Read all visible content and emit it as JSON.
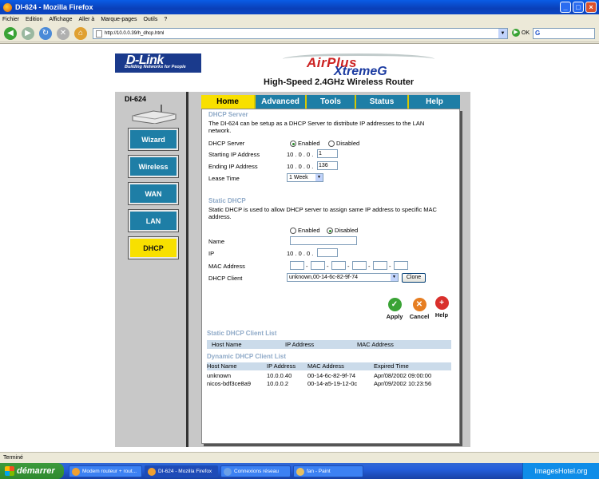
{
  "window": {
    "title": "DI-624 - Mozilla Firefox"
  },
  "menu": [
    "Fichier",
    "Edition",
    "Affichage",
    "Aller à",
    "Marque-pages",
    "Outils",
    "?"
  ],
  "nav": {
    "url": "http://10.0.0.39/h_dhcp.html",
    "ok_label": "OK"
  },
  "router": {
    "brand": "D-Link",
    "tagline": "Building Networks for People",
    "product_line1": "AirPlus",
    "product_line2": "XtremeG",
    "headline": "High-Speed 2.4GHz Wireless Router",
    "model": "DI-624",
    "sidebar": [
      {
        "label": "Wizard"
      },
      {
        "label": "Wireless"
      },
      {
        "label": "WAN"
      },
      {
        "label": "LAN"
      },
      {
        "label": "DHCP"
      }
    ],
    "tabs": [
      {
        "label": "Home"
      },
      {
        "label": "Advanced"
      },
      {
        "label": "Tools"
      },
      {
        "label": "Status"
      },
      {
        "label": "Help"
      }
    ]
  },
  "dhcp": {
    "title": "DHCP Server",
    "desc": "The DI-624 can be setup as a DHCP Server to distribute IP addresses to the LAN network.",
    "server_label": "DHCP Server",
    "enabled": "Enabled",
    "disabled": "Disabled",
    "start_label": "Starting IP Address",
    "start_prefix": "10 . 0 . 0 .",
    "start_value": "1",
    "end_label": "Ending IP Address",
    "end_prefix": "10 . 0 . 0 .",
    "end_value": "136",
    "lease_label": "Lease Time",
    "lease_value": "1 Week"
  },
  "static": {
    "title": "Static DHCP",
    "desc": "Static DHCP is used to allow DHCP server to assign same IP address to specific MAC address.",
    "enabled": "Enabled",
    "disabled": "Disabled",
    "name_label": "Name",
    "ip_label": "IP",
    "ip_prefix": "10 . 0 . 0 .",
    "mac_label": "MAC Address",
    "client_label": "DHCP Client",
    "client_value": "unknown,00-14-6c-82-9f-74",
    "clone_label": "Clone"
  },
  "actions": {
    "apply": "Apply",
    "cancel": "Cancel",
    "help": "Help"
  },
  "static_list": {
    "title": "Static DHCP Client List",
    "cols": [
      "Host Name",
      "IP Address",
      "MAC Address"
    ]
  },
  "dynamic_list": {
    "title": "Dynamic DHCP Client List",
    "cols": [
      "Host Name",
      "IP Address",
      "MAC Address",
      "Expired Time"
    ],
    "rows": [
      {
        "host": "unknown",
        "ip": "10.0.0.40",
        "mac": "00-14-6c-82-9f-74",
        "expires": "Apr/08/2002 09:00:00"
      },
      {
        "host": "nicos-bdf3ce8a9",
        "ip": "10.0.0.2",
        "mac": "00-14-a5-19-12-0c",
        "expires": "Apr/09/2002 10:23:56"
      }
    ]
  },
  "status": {
    "text": "Terminé"
  },
  "taskbar": {
    "start": "démarrer",
    "items": [
      {
        "label": "Modem routeur + rout..."
      },
      {
        "label": "DI-624 - Mozilla Firefox"
      },
      {
        "label": "Connexions réseau"
      },
      {
        "label": "fan - Paint"
      }
    ],
    "tray": "ImagesHotel.org"
  }
}
